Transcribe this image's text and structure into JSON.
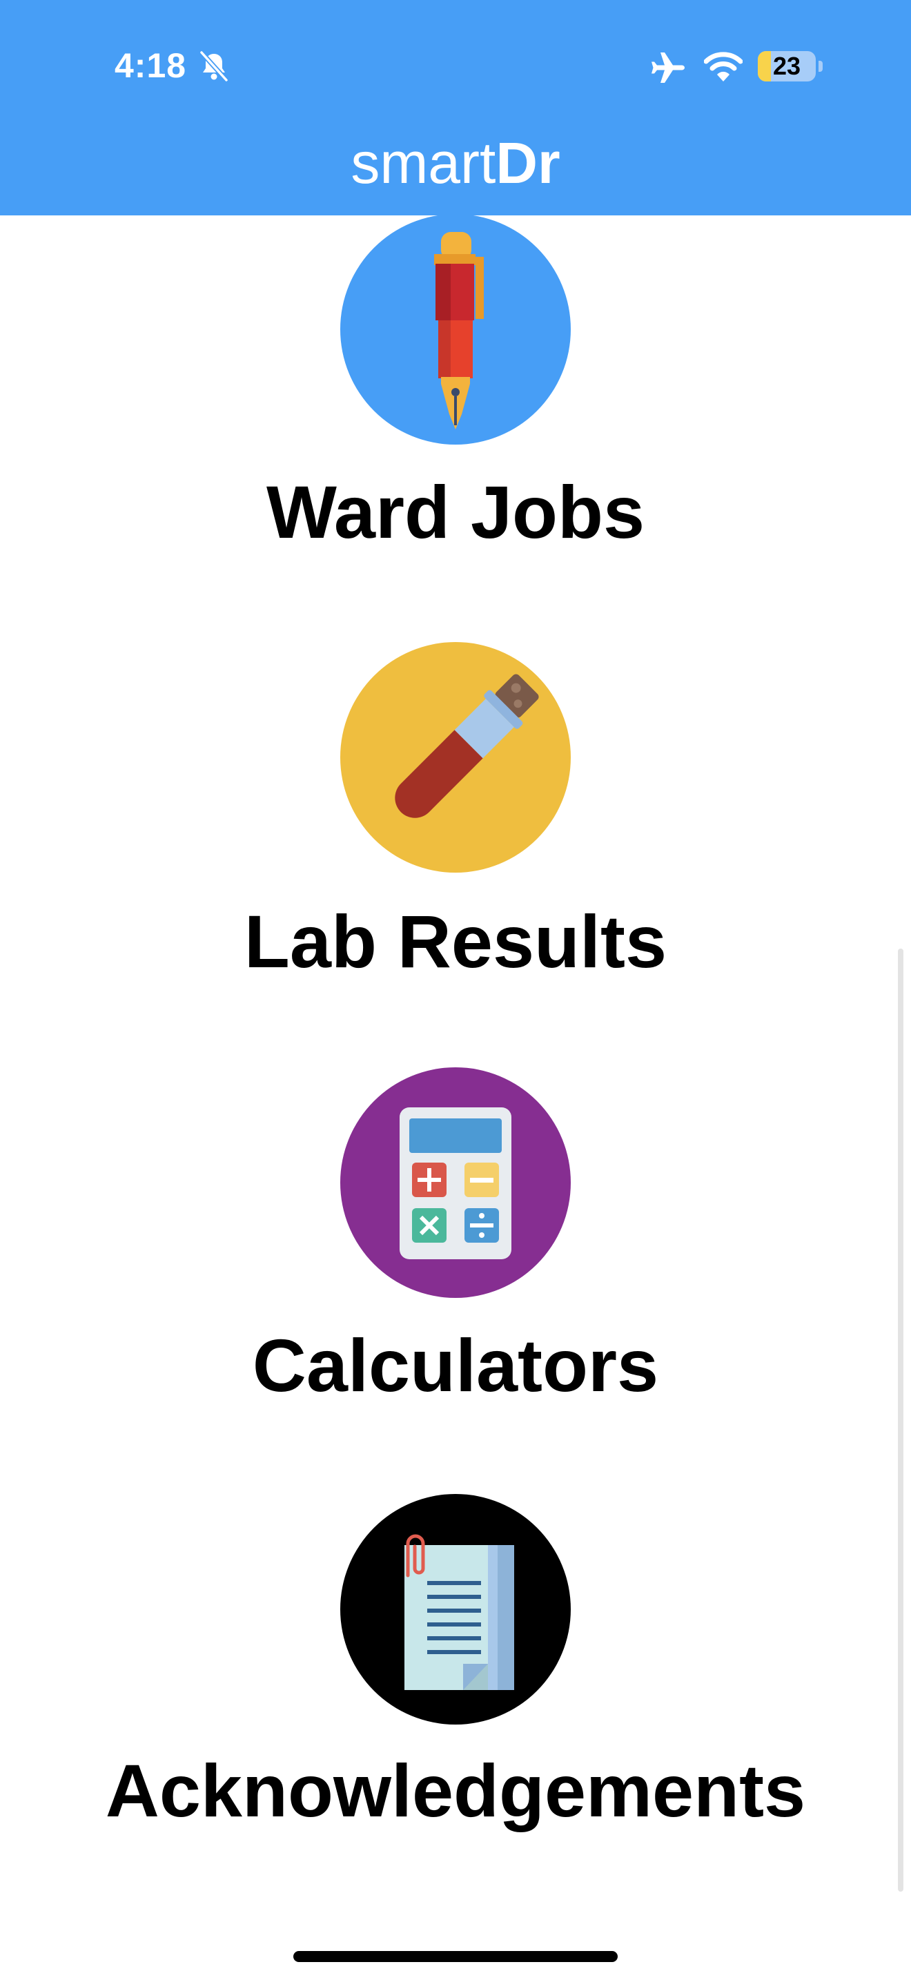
{
  "status_bar": {
    "time": "4:18",
    "battery": "23",
    "battery_level": 0.23,
    "icons": [
      "bell-slash-icon",
      "airplane-icon",
      "wifi-icon",
      "battery-icon"
    ]
  },
  "header": {
    "title_thin": "smart",
    "title_bold": "Dr",
    "background": "#479ef6"
  },
  "menu": {
    "items": [
      {
        "label": "Ward Jobs",
        "icon": "fountain-pen-icon",
        "color": "#479ef6"
      },
      {
        "label": "Lab Results",
        "icon": "test-tube-icon",
        "color": "#efbe3f"
      },
      {
        "label": "Calculators",
        "icon": "calculator-icon",
        "color": "#862e91"
      },
      {
        "label": "Acknowledgements",
        "icon": "notepad-icon",
        "color": "#000000"
      }
    ]
  }
}
